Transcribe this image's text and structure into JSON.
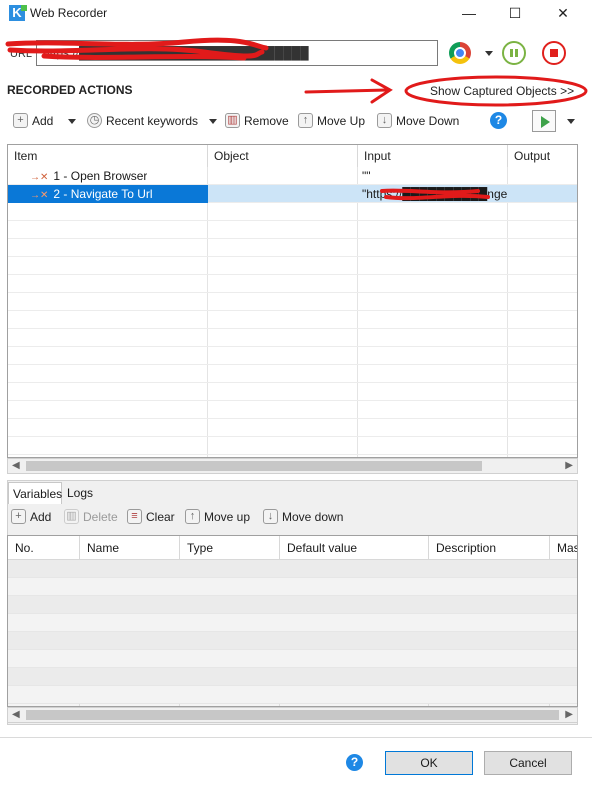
{
  "window": {
    "title": "Web Recorder",
    "minimize": "—",
    "maximize": "☐",
    "close": "✕"
  },
  "url_bar": {
    "label": "URL",
    "value": "https://███████████████████████████"
  },
  "recorded_actions": {
    "title": "RECORDED ACTIONS",
    "show_captured": "Show Captured Objects >>",
    "toolbar": {
      "add": "Add",
      "recent_keywords": "Recent keywords",
      "remove": "Remove",
      "move_up": "Move Up",
      "move_down": "Move Down"
    },
    "columns": [
      "Item",
      "Object",
      "Input",
      "Output"
    ],
    "rows": [
      {
        "item": "1 - Open Browser",
        "object": "",
        "input": "\"\"",
        "output": ""
      },
      {
        "item": "2 - Navigate To Url",
        "object": "",
        "input": "\"https://██████████ngetest",
        "output": ""
      }
    ]
  },
  "bottom_tabs": {
    "variables": "Variables",
    "logs": "Logs"
  },
  "variables_toolbar": {
    "add": "Add",
    "delete": "Delete",
    "clear": "Clear",
    "move_up": "Move up",
    "move_down": "Move down"
  },
  "variables_table": {
    "columns": [
      "No.",
      "Name",
      "Type",
      "Default value",
      "Description",
      "Mas"
    ]
  },
  "footer": {
    "ok": "OK",
    "cancel": "Cancel"
  },
  "icons": {
    "app": "katalon-logo-icon",
    "browser": "chrome-icon",
    "pause": "pause-icon",
    "stop": "stop-icon",
    "help": "help-icon",
    "run": "play-icon"
  },
  "colors": {
    "selection": "#0a78d7",
    "selection_row": "#cce4f7",
    "pause": "#7bb343",
    "stop": "#e0201c",
    "annotation": "#e11a1a"
  }
}
